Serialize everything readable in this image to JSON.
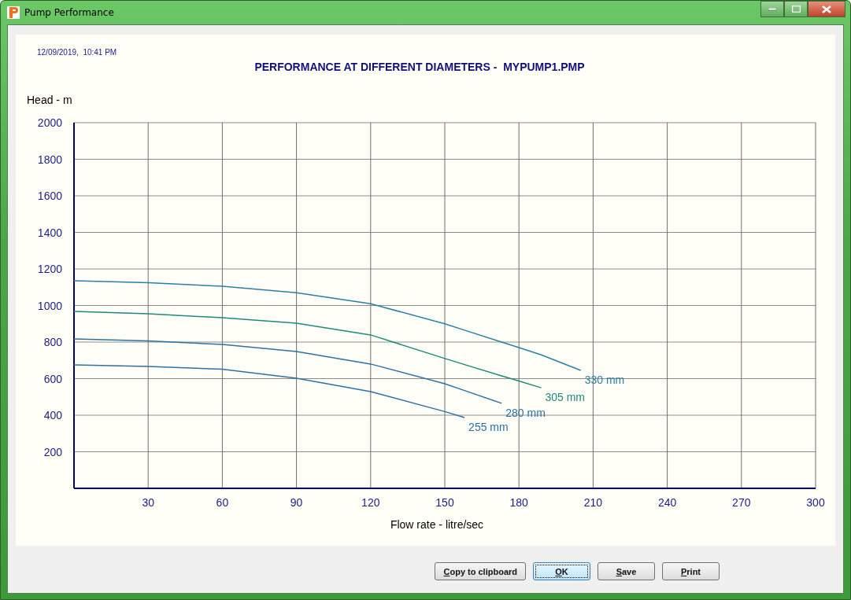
{
  "window": {
    "title": "Pump Performance"
  },
  "report": {
    "timestamp": "12/09/2019,  10:41 PM",
    "chart_data": {
      "type": "line",
      "title": "PERFORMANCE AT DIFFERENT DIAMETERS -  MYPUMP1.PMP",
      "xlabel": "Flow rate - litre/sec",
      "ylabel": "Head - m",
      "x": [
        0,
        30,
        60,
        90,
        120,
        150,
        158,
        173,
        180,
        189,
        205
      ],
      "xlim": [
        0,
        300
      ],
      "ylim": [
        0,
        2000
      ],
      "xticks": [
        30,
        60,
        90,
        120,
        150,
        180,
        210,
        240,
        270,
        300
      ],
      "yticks": [
        200,
        400,
        600,
        800,
        1000,
        1200,
        1400,
        1600,
        1800,
        2000
      ],
      "grid": true,
      "series": [
        {
          "name": "330 mm",
          "color": "#2b7fa6",
          "values": [
            1135,
            1125,
            1105,
            1070,
            1010,
            900,
            865,
            800,
            770,
            730,
            645
          ]
        },
        {
          "name": "305 mm",
          "color": "#1f8a7c",
          "values": [
            968,
            955,
            933,
            903,
            839,
            710,
            677,
            615,
            587,
            550,
            null
          ]
        },
        {
          "name": "280 mm",
          "color": "#2b72a6",
          "values": [
            817,
            806,
            787,
            748,
            680,
            572,
            535,
            465,
            null,
            null,
            null
          ]
        },
        {
          "name": "255 mm",
          "color": "#2b72a6",
          "values": [
            675,
            667,
            651,
            602,
            529,
            420,
            387,
            null,
            null,
            null,
            null
          ]
        }
      ]
    }
  },
  "buttons": [
    {
      "label": "Copy to clipboard",
      "first_letter_underlined": true,
      "focused": false
    },
    {
      "label": "OK",
      "first_letter_underlined": true,
      "focused": true
    },
    {
      "label": "Save",
      "first_letter_underlined": true,
      "focused": false
    },
    {
      "label": "Print",
      "first_letter_underlined": true,
      "focused": false
    }
  ]
}
